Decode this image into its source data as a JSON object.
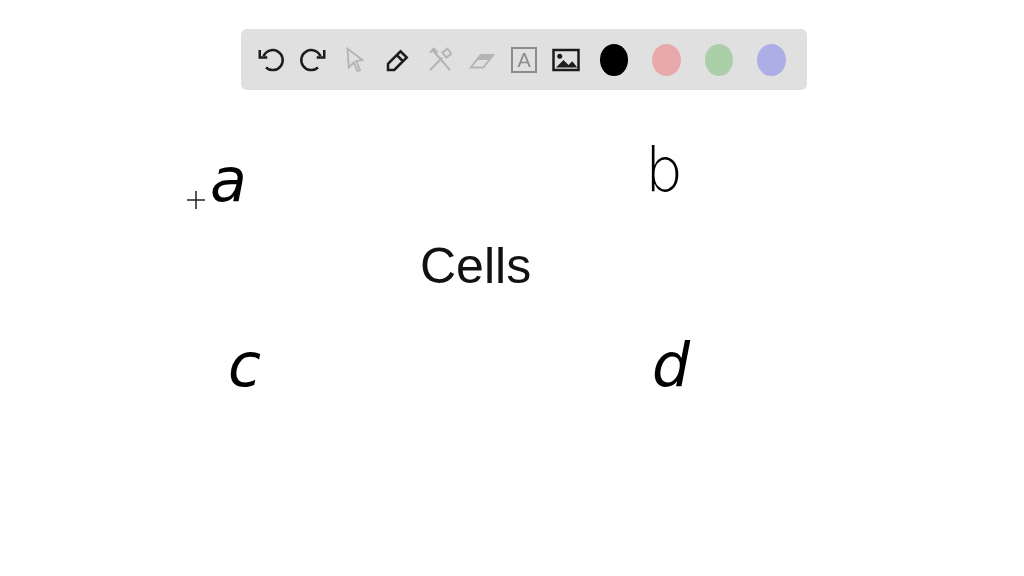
{
  "toolbar": {
    "tools": [
      {
        "kind": "undo",
        "disabled": false
      },
      {
        "kind": "redo",
        "disabled": false
      },
      {
        "kind": "pointer",
        "disabled": true
      },
      {
        "kind": "pen",
        "disabled": false
      },
      {
        "kind": "tools",
        "disabled": true
      },
      {
        "kind": "eraser",
        "disabled": true
      },
      {
        "kind": "text",
        "disabled": true,
        "glyph": "A"
      },
      {
        "kind": "image",
        "disabled": false
      }
    ],
    "colors": [
      {
        "color": "#000000"
      },
      {
        "color": "#e8a9aa"
      },
      {
        "color": "#abcfa9"
      },
      {
        "color": "#aeaee6"
      }
    ]
  },
  "canvas": {
    "title": "Cells",
    "labels": [
      {
        "text": "a"
      },
      {
        "text": "b"
      },
      {
        "text": "c"
      },
      {
        "text": "d"
      }
    ]
  }
}
